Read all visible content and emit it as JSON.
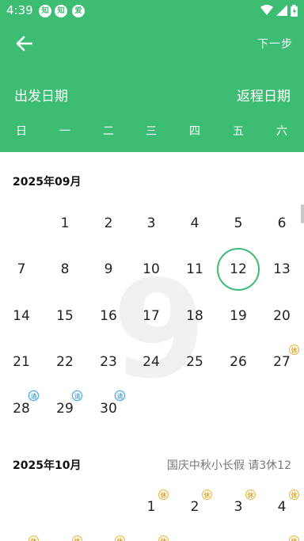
{
  "status_bar": {
    "time": "4:39",
    "notifications": [
      "知",
      "知",
      "爱"
    ]
  },
  "header": {
    "next_label": "下一步",
    "depart_label": "出发日期",
    "return_label": "返程日期",
    "weekdays": [
      "日",
      "一",
      "二",
      "三",
      "四",
      "五",
      "六"
    ]
  },
  "watermark": "9",
  "months": [
    {
      "title": "2025年09月",
      "holiday_note": "",
      "rows": [
        [
          "",
          "1",
          "2",
          "3",
          "4",
          "5",
          "6"
        ],
        [
          "7",
          "8",
          "9",
          "10",
          "11",
          "12",
          "13"
        ],
        [
          "14",
          "15",
          "16",
          "17",
          "18",
          "19",
          "20"
        ],
        [
          "21",
          "22",
          "23",
          "24",
          "25",
          "26",
          "27"
        ],
        [
          "28",
          "29",
          "30",
          "",
          "",
          "",
          ""
        ]
      ],
      "selected_day": "12"
    },
    {
      "title": "2025年10月",
      "holiday_note": "国庆中秋小长假 请3休12",
      "rows": [
        [
          "",
          "",
          "",
          "1",
          "2",
          "3",
          "4"
        ]
      ]
    }
  ],
  "badges": {
    "work": "请",
    "rest": "休"
  },
  "colors": {
    "brand": "#3dbd73",
    "work_badge": "#3aa7d9",
    "rest_badge": "#e8b64c"
  }
}
